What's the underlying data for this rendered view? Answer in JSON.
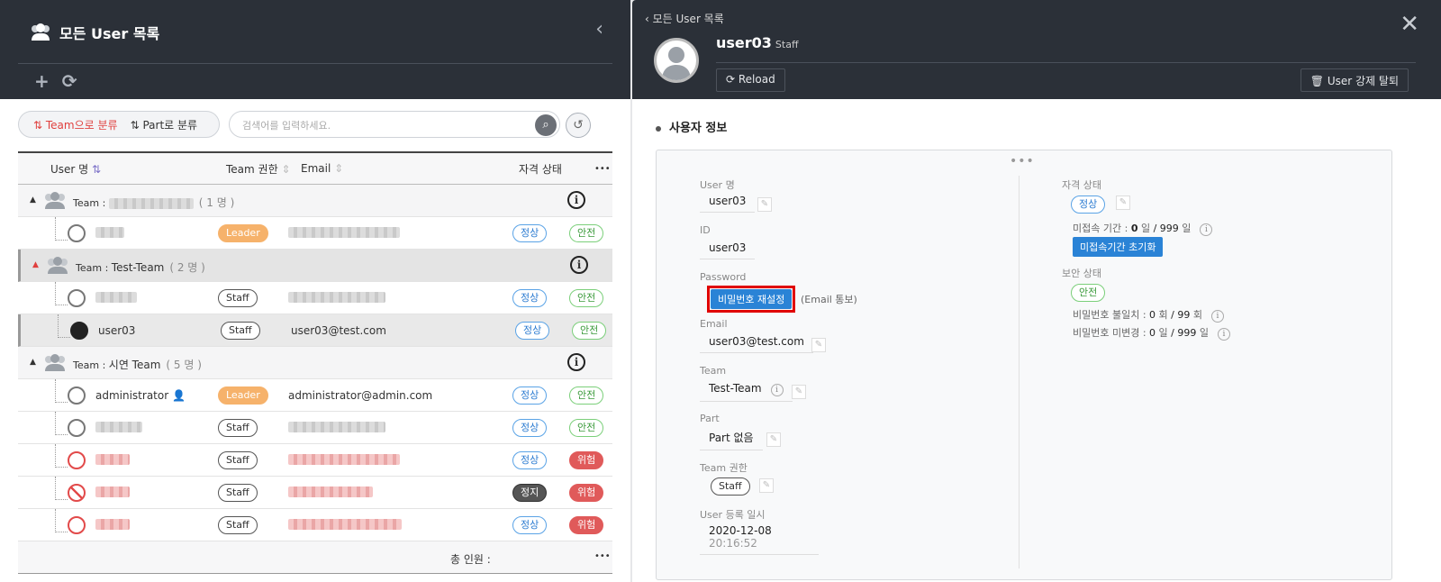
{
  "left": {
    "title": "모든 User 목록",
    "filters": {
      "team": "Team으로 분류",
      "part": "Part로 분류"
    },
    "search_placeholder": "검색어를 입력하세요.",
    "columns": {
      "user": "User 명",
      "perm": "Team 권한",
      "email": "Email",
      "status": "자격 상태",
      "more": "•••"
    },
    "groups": [
      {
        "prefix": "Team : ",
        "name": "",
        "count": "( 1 명 )"
      },
      {
        "prefix": "Team : ",
        "name": "Test-Team",
        "count": "( 2 명 )"
      },
      {
        "prefix": "Team : ",
        "name": "시연 Team",
        "count": "( 5 명 )"
      }
    ],
    "users": {
      "u3": {
        "name": "user03",
        "perm": "Staff",
        "email": "user03@test.com"
      },
      "admin": {
        "name": "administrator",
        "perm": "Leader",
        "email": "administrator@admin.com"
      }
    },
    "labels": {
      "leader": "Leader",
      "staff": "Staff",
      "ok": "정상",
      "stop": "정지",
      "safe": "안전",
      "danger": "위험"
    },
    "footer": {
      "total": "총 인원 :",
      "more": "•••"
    }
  },
  "right": {
    "back": "모든 User 목록",
    "username": "user03",
    "role": "Staff",
    "reload": "Reload",
    "force_remove": "User 강제 탈퇴",
    "section": "사용자 정보",
    "fields": {
      "user_label": "User 명",
      "user_val": "user03",
      "id_label": "ID",
      "id_val": "user03",
      "pw_label": "Password",
      "pw_btn": "비밀번호 재설정",
      "pw_note": "(Email 통보)",
      "email_label": "Email",
      "email_val": "user03@test.com",
      "team_label": "Team",
      "team_val": "Test-Team",
      "part_label": "Part",
      "part_val": "Part 없음",
      "perm_label": "Team 권한",
      "perm_val": "Staff",
      "reg_label": "User 등록 일시",
      "reg_date": "2020-12-08",
      "reg_time": "20:16:52"
    },
    "status": {
      "label": "자격 상태",
      "val": "정상",
      "inactive_label": "미접속 기간 :",
      "inactive_val": "0",
      "inactive_unit": "일",
      "inactive_max": "/ 999",
      "inactive_max_unit": "일",
      "reset_btn": "미접속기간 초기화",
      "sec_label": "보안 상태",
      "sec_val": "안전",
      "pw_mis_label": "비밀번호 불일치 :",
      "pw_mis_val": "0",
      "pw_mis_unit": "회",
      "pw_mis_max": "/ 99",
      "pw_mis_max_unit": "회",
      "pw_nochg_label": "비밀번호 미변경 :",
      "pw_nochg_val": "0",
      "pw_nochg_unit": "일",
      "pw_nochg_max": "/ 999",
      "pw_nochg_max_unit": "일"
    },
    "highlight_color": "#e00000"
  }
}
